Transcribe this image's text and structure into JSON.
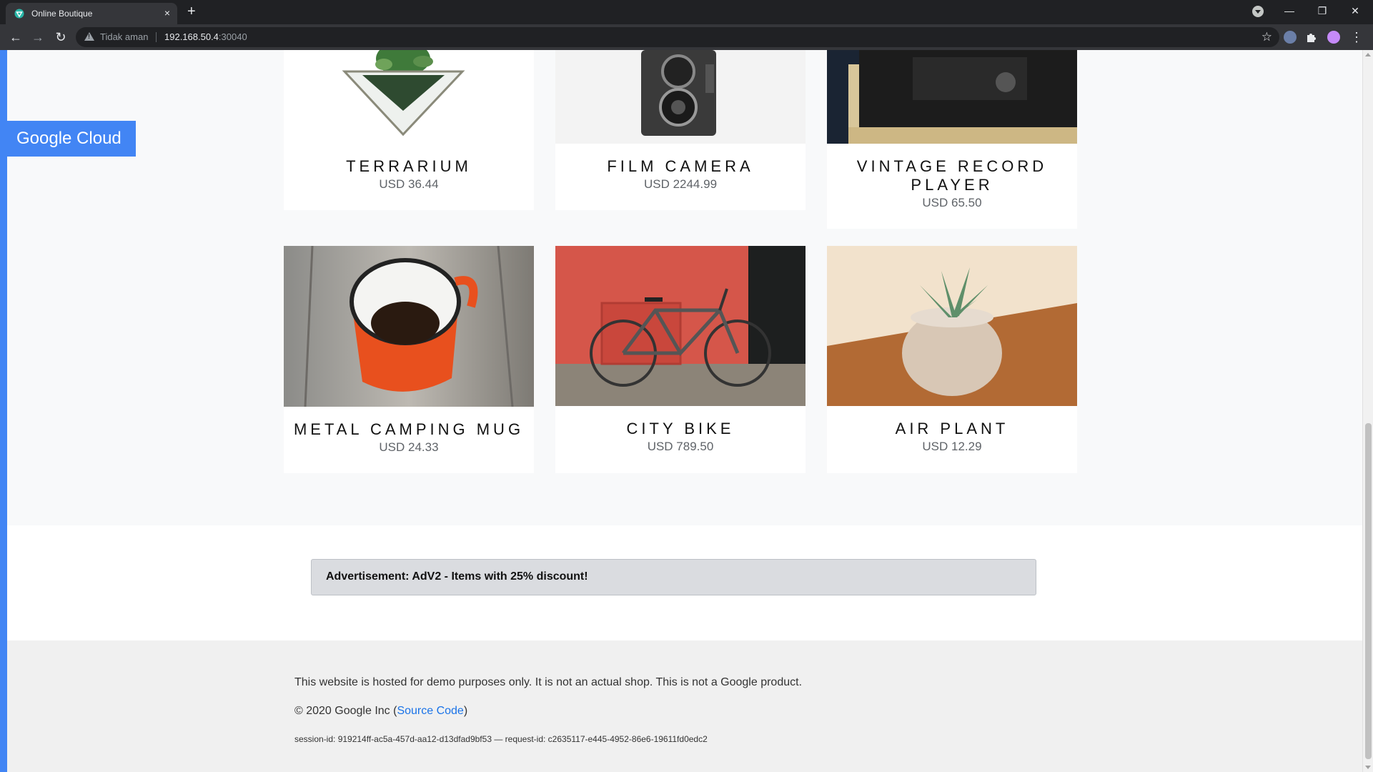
{
  "browser": {
    "tab_title": "Online Boutique",
    "tab_close": "×",
    "new_tab": "+",
    "security_label": "Tidak aman",
    "url_host": "192.168.50.4",
    "url_port": ":30040",
    "window_minimize": "—",
    "window_restore": "❐",
    "window_close": "✕",
    "back": "←",
    "forward": "→",
    "reload": "↻",
    "star": "☆",
    "menu": "⋮"
  },
  "brand": {
    "badge": "Google Cloud"
  },
  "products": [
    {
      "name": "Terrarium",
      "price": "USD 36.44"
    },
    {
      "name": "Film Camera",
      "price": "USD 2244.99"
    },
    {
      "name": "Vintage Record Player",
      "price": "USD 65.50"
    },
    {
      "name": "Metal Camping Mug",
      "price": "USD 24.33"
    },
    {
      "name": "City Bike",
      "price": "USD 789.50"
    },
    {
      "name": "Air Plant",
      "price": "USD 12.29"
    }
  ],
  "ad": {
    "text": "Advertisement: AdV2 - Items with 25% discount!"
  },
  "footer": {
    "disclaimer": "This website is hosted for demo purposes only. It is not an actual shop. This is not a Google product.",
    "copyright_prefix": "© 2020 Google Inc (",
    "source_link": "Source Code",
    "copyright_suffix": ")",
    "session": "session-id: 919214ff-ac5a-457d-aa12-d13dfad9bf53 — request-id: c2635117-e445-4952-86e6-19611fd0edc2"
  },
  "colors": {
    "accent": "#4285f4",
    "link": "#1a73e8",
    "page_bg": "#f8f9fa"
  }
}
